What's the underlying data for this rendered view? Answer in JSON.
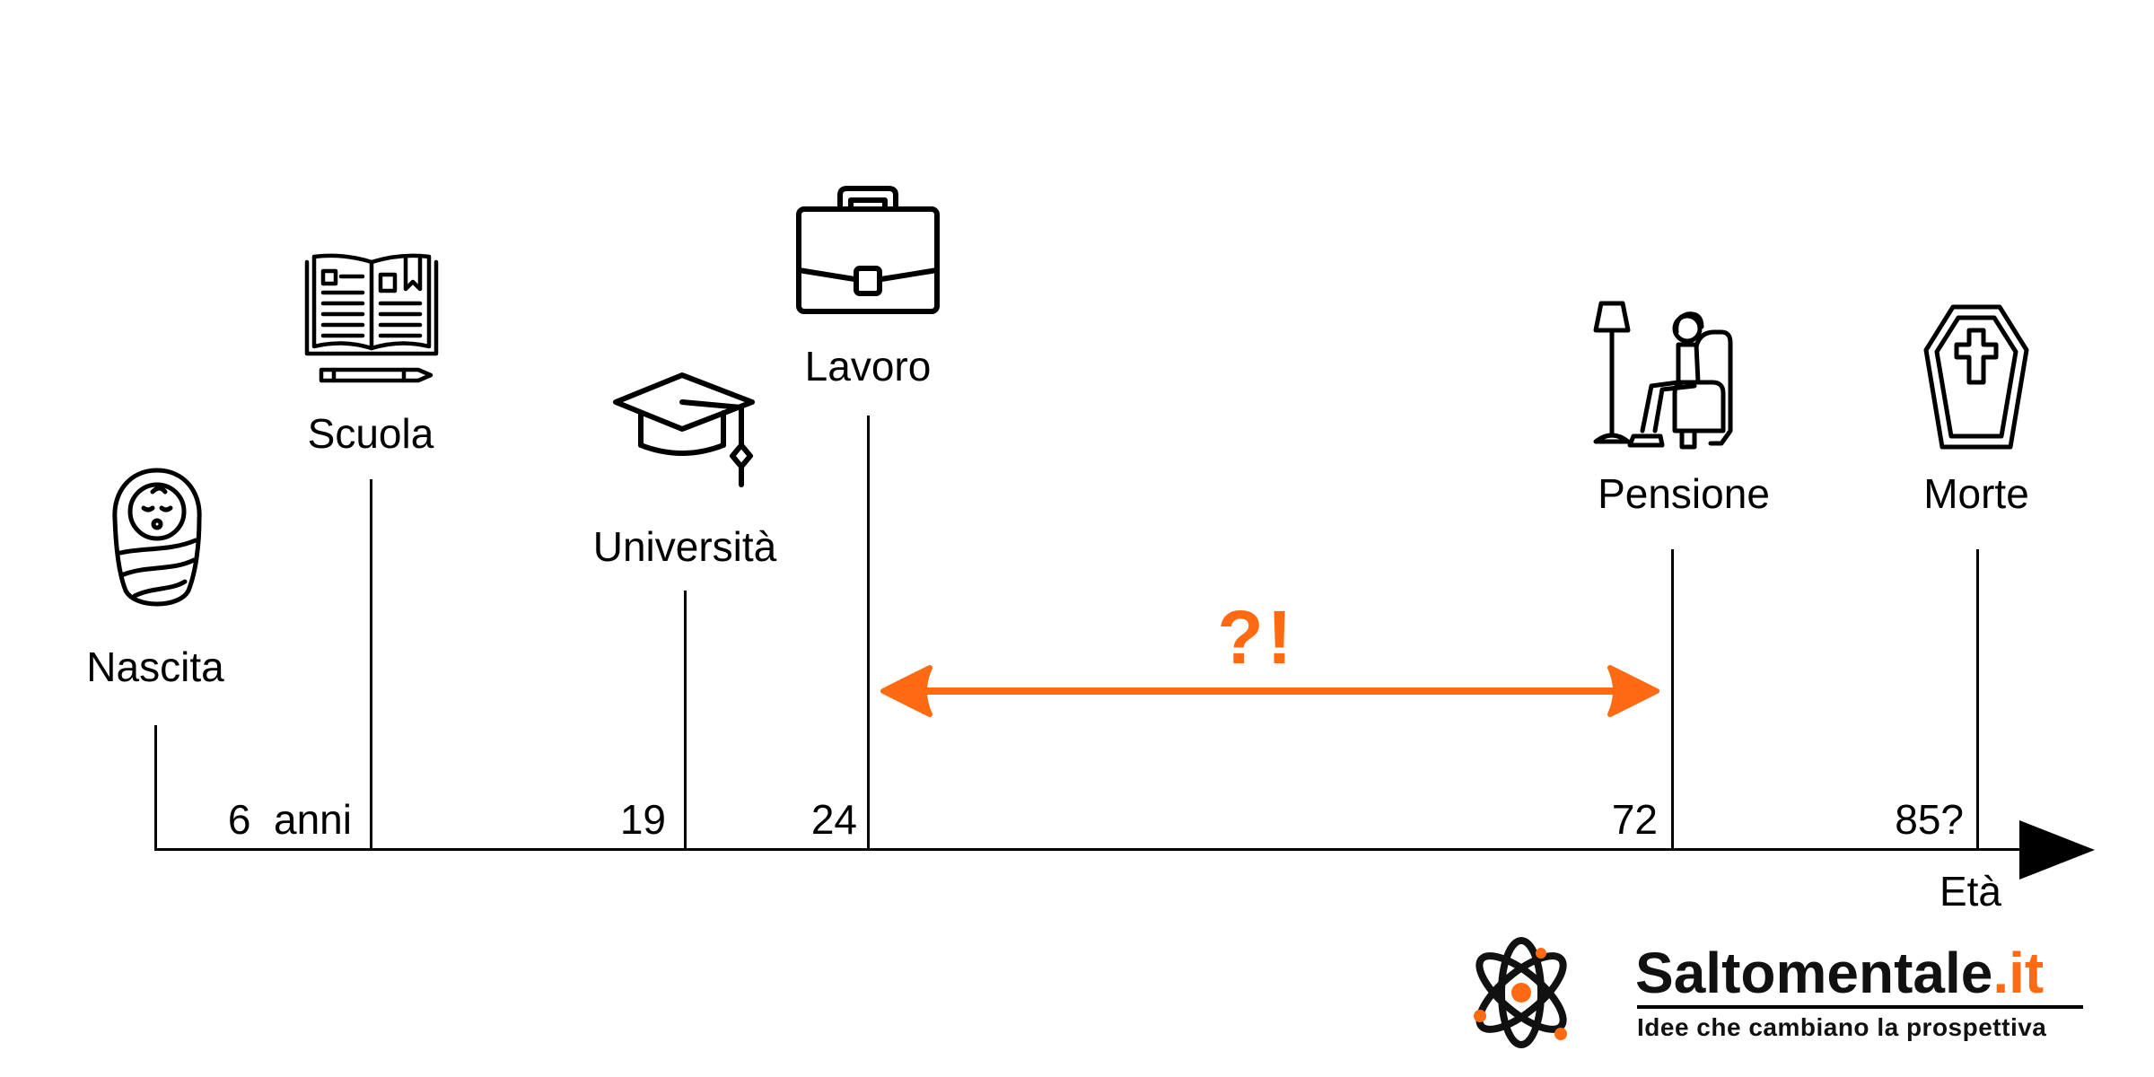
{
  "milestones": [
    {
      "label": "Nascita",
      "age": "",
      "icon": "swaddled-baby-icon"
    },
    {
      "label": "Scuola",
      "age": "6  anni",
      "icon": "open-book-icon"
    },
    {
      "label": "Università",
      "age": "19",
      "icon": "graduation-cap-icon"
    },
    {
      "label": "Lavoro",
      "age": "24",
      "icon": "briefcase-icon"
    },
    {
      "label": "Pensione",
      "age": "72",
      "icon": "armchair-retiree-icon"
    },
    {
      "label": "Morte",
      "age": "85?",
      "icon": "coffin-icon"
    }
  ],
  "axis": {
    "label": "Età"
  },
  "range": {
    "label": "?!",
    "from": "24",
    "to": "72",
    "color": "#ff6a13"
  },
  "brand": {
    "name": "Saltomentale",
    "suffix": ".it",
    "tagline": "Idee che cambiano la prospettiva",
    "accent_color": "#ff6a13",
    "logo_icon": "atom-icon"
  }
}
